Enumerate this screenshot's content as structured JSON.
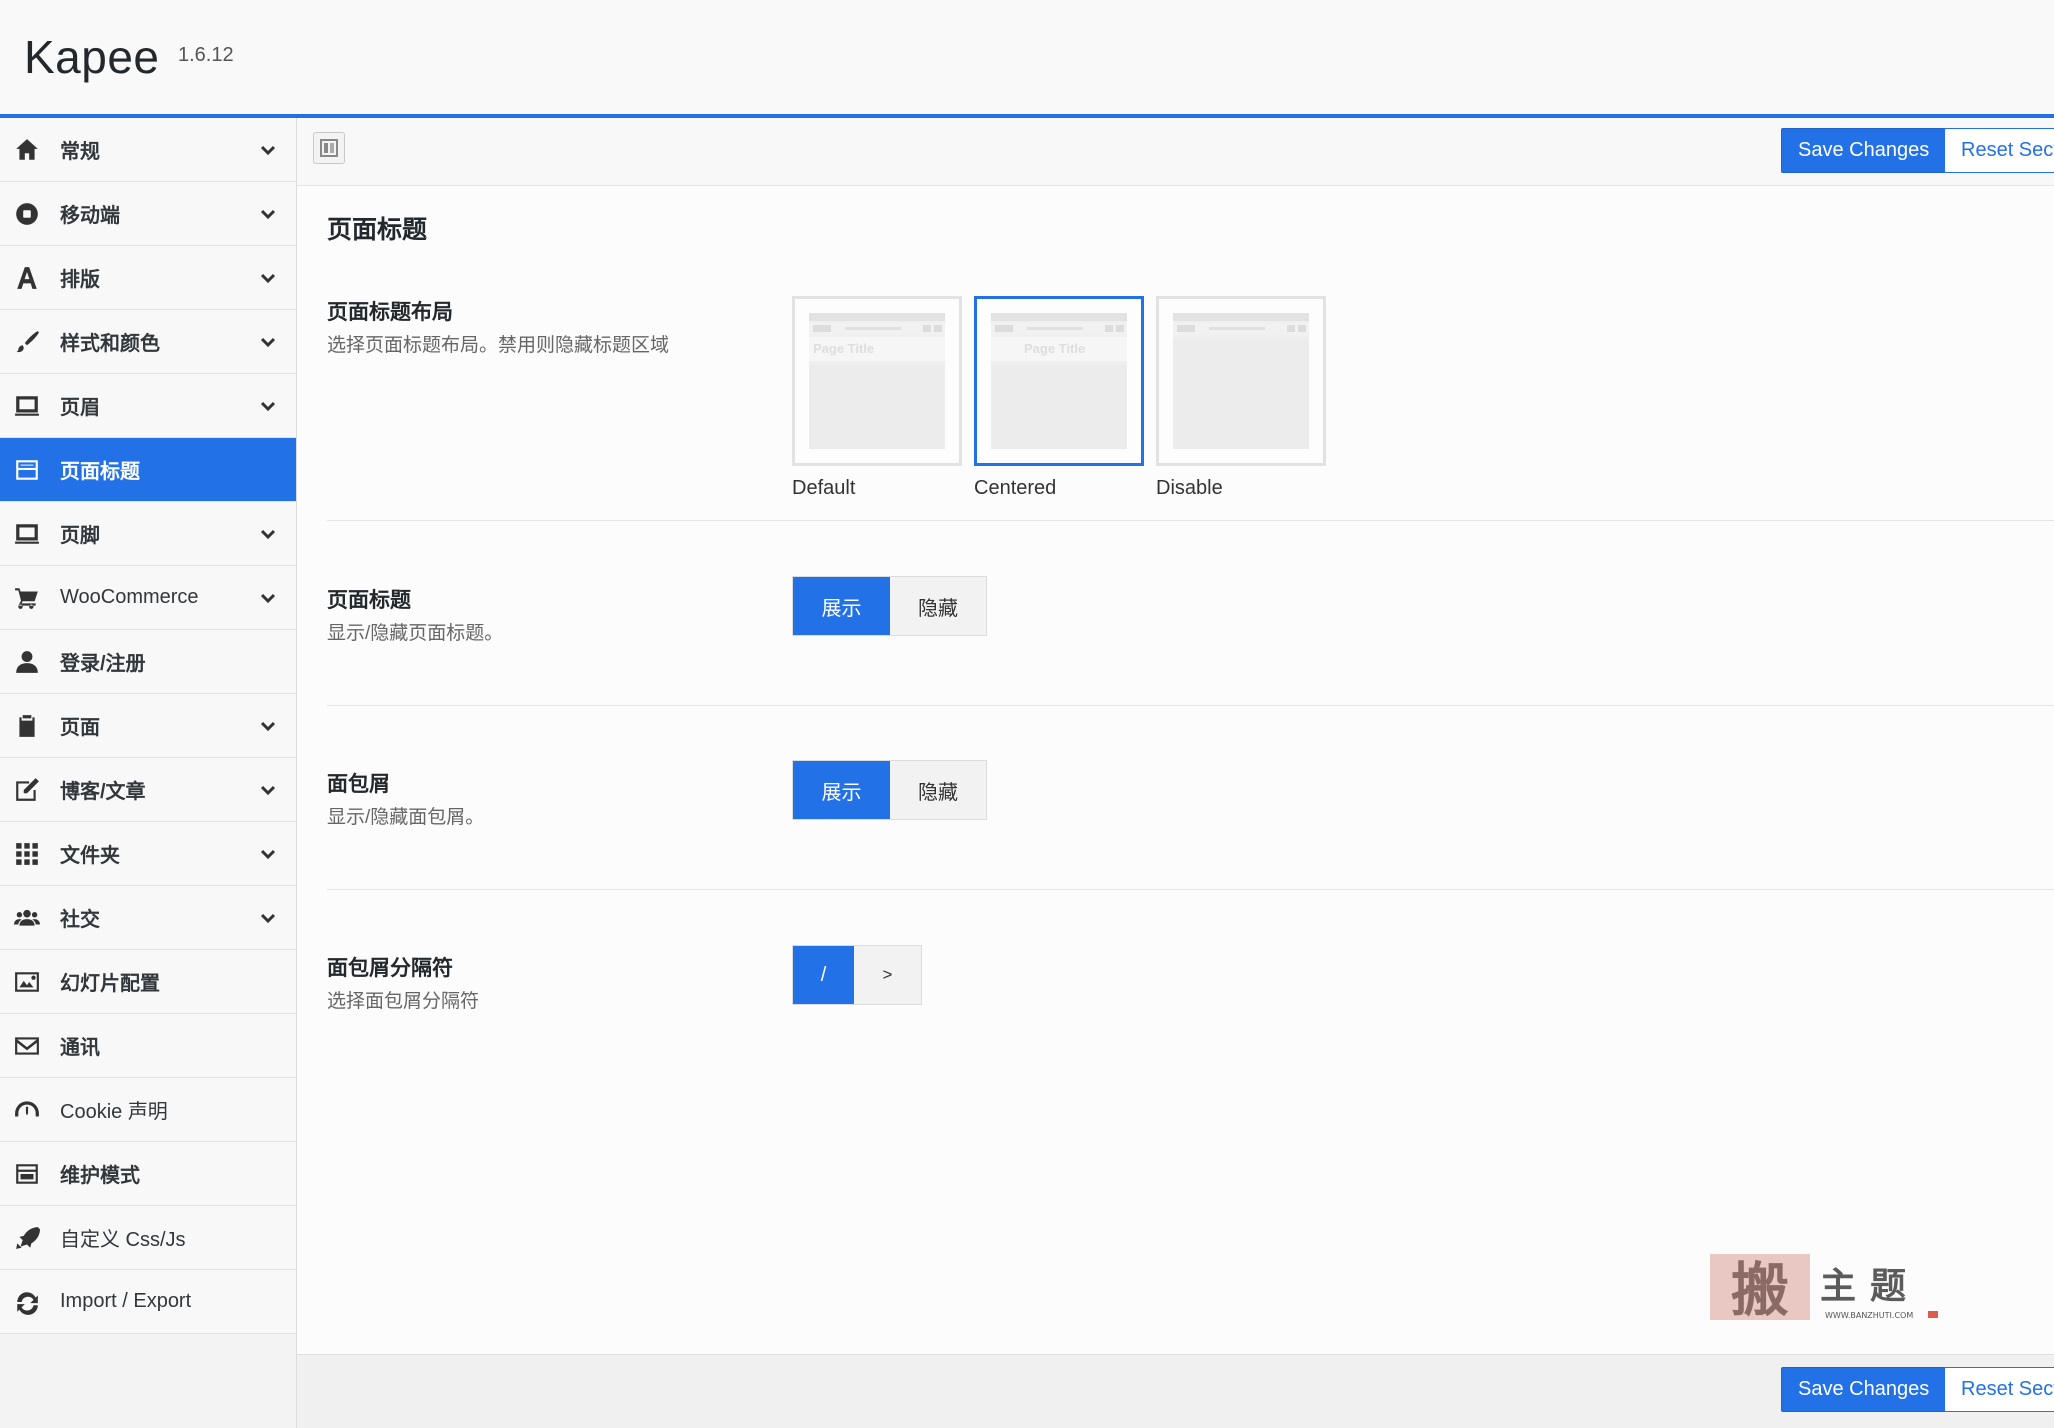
{
  "header": {
    "theme_name": "Kapee",
    "version": "1.6.12"
  },
  "sidebar": {
    "items": [
      {
        "label": "常规",
        "icon": "home-icon",
        "has_children": true,
        "active": false
      },
      {
        "label": "移动端",
        "icon": "mobile-icon",
        "has_children": true,
        "active": false
      },
      {
        "label": "排版",
        "icon": "typography-icon",
        "has_children": true,
        "active": false
      },
      {
        "label": "样式和颜色",
        "icon": "brush-icon",
        "has_children": true,
        "active": false
      },
      {
        "label": "页眉",
        "icon": "header-icon",
        "has_children": true,
        "active": false
      },
      {
        "label": "页面标题",
        "icon": "page-title-icon",
        "has_children": false,
        "active": true
      },
      {
        "label": "页脚",
        "icon": "footer-icon",
        "has_children": true,
        "active": false
      },
      {
        "label": "WooCommerce",
        "icon": "cart-icon",
        "has_children": true,
        "active": false
      },
      {
        "label": "登录/注册",
        "icon": "user-icon",
        "has_children": false,
        "active": false
      },
      {
        "label": "页面",
        "icon": "clipboard-icon",
        "has_children": true,
        "active": false
      },
      {
        "label": "博客/文章",
        "icon": "edit-icon",
        "has_children": true,
        "active": false
      },
      {
        "label": "文件夹",
        "icon": "grid-icon",
        "has_children": true,
        "active": false
      },
      {
        "label": "社交",
        "icon": "group-icon",
        "has_children": true,
        "active": false
      },
      {
        "label": "幻灯片配置",
        "icon": "image-icon",
        "has_children": false,
        "active": false
      },
      {
        "label": "通讯",
        "icon": "envelope-icon",
        "has_children": false,
        "active": false
      },
      {
        "label": "Cookie 声明",
        "icon": "gauge-icon",
        "has_children": false,
        "active": false
      },
      {
        "label": "维护模式",
        "icon": "maintenance-icon",
        "has_children": false,
        "active": false
      },
      {
        "label": "自定义 Css/Js",
        "icon": "rocket-icon",
        "has_children": false,
        "active": false
      },
      {
        "label": "Import / Export",
        "icon": "refresh-icon",
        "has_children": false,
        "active": false
      }
    ]
  },
  "toolbar": {
    "save_label": "Save Changes",
    "reset_label": "Reset Section"
  },
  "section": {
    "title": "页面标题",
    "fields": [
      {
        "title": "页面标题布局",
        "description": "选择页面标题布局。禁用则隐藏标题区域",
        "type": "image_select",
        "options": [
          {
            "caption": "Default",
            "thumb_logo": "LOGO",
            "thumb_title": "Page Title",
            "thumb_align": "left"
          },
          {
            "caption": "Centered",
            "thumb_logo": "LOGO",
            "thumb_title": "Page Title",
            "thumb_align": "center"
          },
          {
            "caption": "Disable",
            "thumb_logo": "LOGO",
            "thumb_title": "",
            "thumb_align": "none"
          }
        ],
        "selected": "Centered"
      },
      {
        "title": "页面标题",
        "description": "显示/隐藏页面标题。",
        "type": "button_set",
        "options": [
          "展示",
          "隐藏"
        ],
        "selected": "展示"
      },
      {
        "title": "面包屑",
        "description": "显示/隐藏面包屑。",
        "type": "button_set",
        "options": [
          "展示",
          "隐藏"
        ],
        "selected": "展示"
      },
      {
        "title": "面包屑分隔符",
        "description": "选择面包屑分隔符",
        "type": "button_set",
        "options": [
          "/",
          ">"
        ],
        "selected": "/"
      }
    ]
  },
  "watermark": {
    "main_char": "搬",
    "side_text": "主题",
    "url": "WWW.BANZHUTI.COM"
  },
  "colors": {
    "accent": "#2271e6",
    "sidebar_bg": "#f8f8f8",
    "header_bg": "#f9f9f9"
  }
}
